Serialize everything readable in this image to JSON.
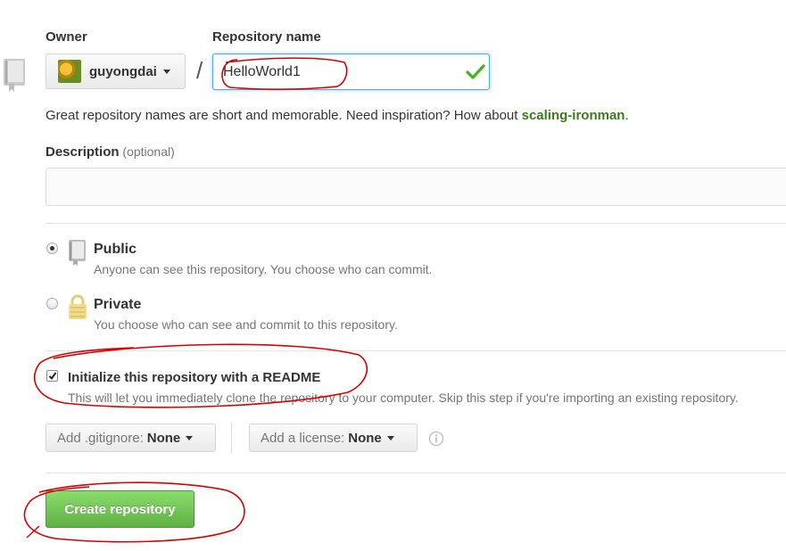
{
  "owner": {
    "label": "Owner",
    "name": "guyongdai"
  },
  "repository": {
    "label": "Repository name",
    "value": "HelloWorld1"
  },
  "hint": {
    "text": "Great repository names are short and memorable. Need inspiration? How about ",
    "suggestion": "scaling-ironman",
    "end": "."
  },
  "description": {
    "label": "Description",
    "optional": "(optional)",
    "value": ""
  },
  "visibility": {
    "public": {
      "title": "Public",
      "desc": "Anyone can see this repository. You choose who can commit.",
      "selected": true
    },
    "private": {
      "title": "Private",
      "desc": "You choose who can see and commit to this repository.",
      "selected": false
    }
  },
  "readme": {
    "title": "Initialize this repository with a README",
    "desc": "This will let you immediately clone the repository to your computer. Skip this step if you're importing an existing repository.",
    "checked": true
  },
  "gitignore": {
    "prefix": "Add .gitignore:",
    "value": "None"
  },
  "license": {
    "prefix": "Add a license:",
    "value": "None"
  },
  "create_button": "Create repository",
  "colors": {
    "accent_green": "#60b044",
    "annotation_red": "#d40000",
    "link_green": "#3b7a1e",
    "focus_blue": "#51a7e8"
  },
  "icons": [
    "repo-icon",
    "chevron-down-icon",
    "check-icon",
    "lock-icon",
    "info-icon"
  ]
}
